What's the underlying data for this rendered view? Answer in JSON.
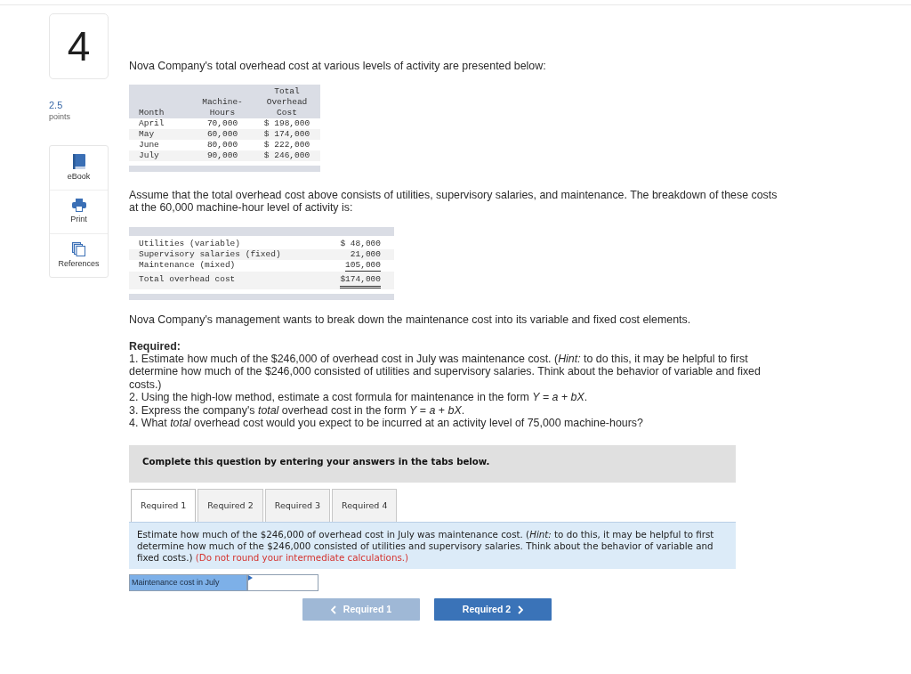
{
  "question": {
    "number": "4",
    "points_value": "2.5",
    "points_label": "points"
  },
  "tools": [
    {
      "label": "eBook"
    },
    {
      "label": "Print"
    },
    {
      "label": "References"
    }
  ],
  "intro": "Nova Company's total overhead cost at various levels of activity are presented below:",
  "activity_table": {
    "columns": [
      "Month",
      "Machine-Hours",
      "Total Overhead Cost"
    ],
    "rows": [
      [
        "April",
        "70,000",
        "$ 198,000"
      ],
      [
        "May",
        "60,000",
        "$ 174,000"
      ],
      [
        "June",
        "80,000",
        "$ 222,000"
      ],
      [
        "July",
        "90,000",
        "$ 246,000"
      ]
    ]
  },
  "breakdown_intro": "Assume that the total overhead cost above consists of utilities, supervisory salaries, and maintenance. The breakdown of these costs at the 60,000 machine-hour level of activity is:",
  "breakdown_table": {
    "rows": [
      {
        "item": "Utilities (variable)",
        "amount": "$ 48,000"
      },
      {
        "item": "Supervisory salaries (fixed)",
        "amount": "21,000"
      },
      {
        "item": "Maintenance (mixed)",
        "amount": "105,000"
      }
    ],
    "total": {
      "item": "Total overhead cost",
      "amount": "$174,000"
    }
  },
  "management_text": "Nova Company's management wants to break down the maintenance cost into its variable and fixed cost elements.",
  "required": {
    "heading": "Required:",
    "items": [
      "1. Estimate how much of the $246,000 of overhead cost in July was maintenance cost. (*Hint:* to do this, it may be helpful to first determine how much of the $246,000 consisted of utilities and supervisory salaries. Think about the behavior of variable and fixed costs.)",
      "2. Using the high-low method, estimate a cost formula for maintenance in the form *Y* = *a* + *bX*.",
      "3. Express the company's *total* overhead cost in the form *Y* = *a* + *bX*.",
      "4. What *total* overhead cost would you expect to be incurred at an activity level of 75,000 machine-hours?"
    ]
  },
  "banner": "Complete this question by entering your answers in the tabs below.",
  "tabs": [
    {
      "label": "Required 1",
      "selected": true
    },
    {
      "label": "Required 2",
      "selected": false
    },
    {
      "label": "Required 3",
      "selected": false
    },
    {
      "label": "Required 4",
      "selected": false
    }
  ],
  "tab_panel": {
    "prompt": "Estimate how much of the $246,000 of overhead cost in July was maintenance cost. (*Hint:* to do this, it may be helpful to first determine how much of the $246,000 consisted of utilities and supervisory salaries. Think about the behavior of variable and fixed costs.)",
    "note": "(Do not round your intermediate calculations.)",
    "answer": {
      "label": "Maintenance cost in July"
    }
  },
  "navigation": [
    {
      "kind": "previous",
      "label": "Required 1",
      "disabled": true
    },
    {
      "kind": "next",
      "label": "Required 2",
      "disabled": false
    }
  ]
}
